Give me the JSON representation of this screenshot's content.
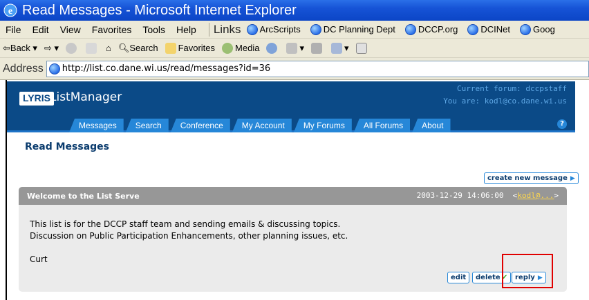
{
  "window": {
    "title": "Read Messages - Microsoft Internet Explorer"
  },
  "menus": [
    "File",
    "Edit",
    "View",
    "Favorites",
    "Tools",
    "Help"
  ],
  "links_bar": {
    "label": "Links",
    "items": [
      "ArcScripts",
      "DC Planning Dept",
      "DCCP.org",
      "DCINet",
      "Goog"
    ]
  },
  "toolbar": {
    "back": "Back",
    "search": "Search",
    "favorites": "Favorites",
    "media": "Media"
  },
  "address": {
    "label": "Address",
    "url": "http://list.co.dane.wi.us/read/messages?id=36"
  },
  "header": {
    "logo": "LYRIS",
    "app_name": "ListManager",
    "forum_line": "Current forum: dccpstaff",
    "user_line": "You are: kodl@co.dane.wi.us"
  },
  "nav": {
    "tabs": [
      "Messages",
      "Search",
      "Conference",
      "My Account",
      "My Forums",
      "All Forums",
      "About"
    ],
    "help": "?"
  },
  "page": {
    "heading": "Read Messages",
    "create_button": "create new message"
  },
  "message": {
    "subject": "Welcome to the List Serve",
    "date": "2003-12-29 14:06:00",
    "author": "kodl@...",
    "body_line1": "This list is for the DCCP staff team and sending emails & discussing topics.",
    "body_line2": "Discussion on Public Participation Enhancements, other planning issues, etc.",
    "signature": "Curt",
    "actions": {
      "edit": "edit",
      "delete": "delete",
      "reply": "reply"
    }
  },
  "colors": {
    "lyris_blue": "#0b4a87",
    "tab_blue": "#2687d8",
    "message_header": "#979797",
    "highlight": "#e00000"
  }
}
